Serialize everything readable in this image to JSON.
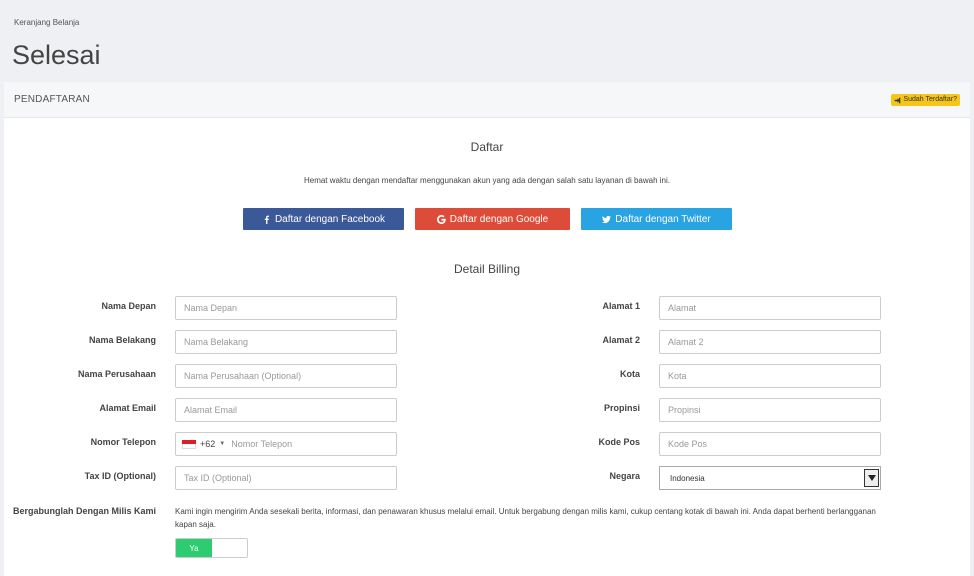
{
  "breadcrumb": "Keranjang Belanja",
  "page_title": "Selesai",
  "panel": {
    "title": "PENDAFTARAN",
    "login_badge": "Sudah Terdaftar?"
  },
  "register": {
    "title": "Daftar",
    "subtitle": "Hemat waktu dengan mendaftar menggunakan akun yang ada dengan salah satu layanan di bawah ini.",
    "facebook": "Daftar dengan Facebook",
    "google": "Daftar dengan Google",
    "twitter": "Daftar dengan Twitter"
  },
  "billing": {
    "title": "Detail Billing",
    "first_name": {
      "label": "Nama Depan",
      "placeholder": "Nama Depan"
    },
    "last_name": {
      "label": "Nama Belakang",
      "placeholder": "Nama Belakang"
    },
    "company": {
      "label": "Nama Perusahaan",
      "placeholder": "Nama Perusahaan (Optional)"
    },
    "email": {
      "label": "Alamat Email",
      "placeholder": "Alamat Email"
    },
    "phone": {
      "label": "Nomor Telepon",
      "code": "+62",
      "placeholder": "Nomor Telepon"
    },
    "tax": {
      "label": "Tax ID (Optional)",
      "placeholder": "Tax ID (Optional)"
    },
    "address1": {
      "label": "Alamat 1",
      "placeholder": "Alamat"
    },
    "address2": {
      "label": "Alamat 2",
      "placeholder": "Alamat 2"
    },
    "city": {
      "label": "Kota",
      "placeholder": "Kota"
    },
    "province": {
      "label": "Propinsi",
      "placeholder": "Propinsi"
    },
    "postcode": {
      "label": "Kode Pos",
      "placeholder": "Kode Pos"
    },
    "country": {
      "label": "Negara",
      "value": "Indonesia"
    }
  },
  "mailing": {
    "label": "Bergabunglah Dengan Milis Kami",
    "text": "Kami ingin mengirim Anda sesekali berita, informasi, dan penawaran khusus melalui email. Untuk bergabung dengan milis kami, cukup centang kotak di bawah ini. Anda dapat berhenti berlangganan kapan saja.",
    "toggle_label": "Ya"
  },
  "colors": {
    "facebook": "#3b5998",
    "google": "#dd4b39",
    "twitter": "#2aa3e2",
    "toggle_on": "#2ecc71",
    "badge": "#f5c518"
  }
}
